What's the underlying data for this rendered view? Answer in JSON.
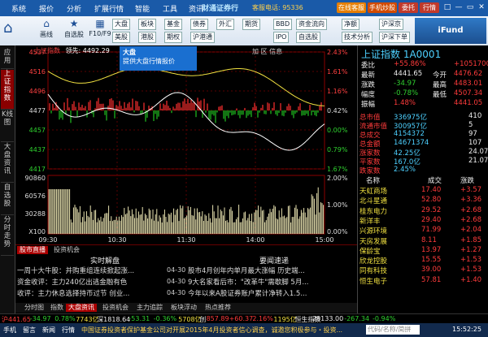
{
  "titlebar": {
    "menu": [
      "系统",
      "报价",
      "分析",
      "扩展行情",
      "智能",
      "工具",
      "资讯"
    ],
    "brand": "财通证券行",
    "hotline": "客服电话: 95336",
    "buttons": [
      "在线客服",
      "手机炒股",
      "委托",
      "行情"
    ],
    "win_controls": [
      "□",
      "—",
      "▭",
      "✕"
    ]
  },
  "toolbar": {
    "tools": [
      {
        "icon": "⌂",
        "label": "画线",
        "name": "draw-line-icon"
      },
      {
        "icon": "★",
        "label": "自选股",
        "name": "watchlist-icon"
      },
      {
        "icon": "▦",
        "label": "F10/F9",
        "name": "f10-icon"
      }
    ],
    "selects": [
      "大盘",
      "板块",
      "基金",
      "债券",
      "外汇",
      "期货",
      "美股",
      "港股",
      "期权",
      "沪港通",
      "BBD",
      "IPO",
      "资金流向",
      "自选股",
      "净额",
      "技术分析",
      "沪深京",
      "沪深下单"
    ],
    "logo": "iFund"
  },
  "left_tabs": [
    "应用",
    "上证指数",
    "K线图",
    "大盘资讯",
    "自选股",
    "分时走势"
  ],
  "chart": {
    "header_name": "上证指数",
    "header_value": "领先: 4492.29",
    "ops": "加 区 信息",
    "tooltip_title": "大盘",
    "tooltip_text": "提供大盘行情报价",
    "y_left": [
      "4537",
      "4516",
      "4496",
      "4477",
      "4457",
      "4437",
      "4417"
    ],
    "y_right": [
      "2.43%",
      "1.61%",
      "1.16%",
      "0.42%",
      "0.00%",
      "0.79%",
      "1.67%"
    ],
    "vol_left": [
      "90860",
      "60576",
      "30288",
      "X100"
    ],
    "vol_right": [
      "2.00%",
      "1.00%",
      "0.00%"
    ],
    "x_labels": [
      "09:30",
      "10:30",
      "11:30",
      "14:00",
      "15:00"
    ]
  },
  "news": {
    "tabs": [
      "股市直播",
      "投资机会"
    ],
    "sub_heads": [
      "实时解盘",
      "要闻速递"
    ],
    "rows": [
      {
        "left": "一周十大牛股：并购重组连续掀起涨...",
        "time": "04-30",
        "right": "股市4月创年内单月最大涨幅 历史端..."
      },
      {
        "left": "资金收评：主力240亿出逃金融有色",
        "time": "04-30",
        "right": "9大名家看后市：\"改革牛\"需歇脚 5月..."
      },
      {
        "left": "收评：主力休息选择持币过节 创业...",
        "time": "04-30",
        "right": "今年以来A股证券账户累计净转入1.5..."
      }
    ],
    "ticker_tabs": [
      "分时图",
      "指数",
      "大盘资讯",
      "投资机会",
      "主力追踪",
      "板块浮动",
      "热点推荐"
    ]
  },
  "right_panel": {
    "title": "上证指数 1A0001",
    "quote": [
      {
        "l": "委比",
        "v": "+55.86%",
        "r": "+10517003"
      },
      {
        "l": "最新",
        "v": "4441.65",
        "r": "4476.62"
      },
      {
        "l": "涨跌",
        "v": "-34.97",
        "r": "4483.01"
      },
      {
        "l": "幅度",
        "v": "-0.78%",
        "r": "4507.34"
      },
      {
        "l": "振幅",
        "v": "1.48%",
        "r": "4441.05"
      }
    ],
    "quote_labels": [
      "今开",
      "最高",
      "最低"
    ],
    "stats": [
      {
        "l": "总市值",
        "v": "336975亿"
      },
      {
        "l": "流通市值",
        "v": "300957亿"
      },
      {
        "l": "总成交",
        "v": "4154372"
      },
      {
        "l": "总金额",
        "v": "14671374"
      },
      {
        "l": "涨家数",
        "v": "42.25亿"
      },
      {
        "l": "平家数",
        "v": "167.0亿"
      },
      {
        "l": "跌家数",
        "v": "2.45%"
      }
    ],
    "stats_right": [
      "410",
      "5",
      "97",
      "107",
      "24.07",
      "21.07"
    ],
    "list_header": [
      "名称",
      "成交",
      "涨跌"
    ],
    "stocks": [
      {
        "name": "天虹商场",
        "price": "17.40",
        "chg": "+3.57"
      },
      {
        "name": "北斗星通",
        "price": "52.80",
        "chg": "+3.36"
      },
      {
        "name": "桂东电力",
        "price": "29.52",
        "chg": "+2.68"
      },
      {
        "name": "新洋丰",
        "price": "29.40",
        "chg": "+2.68"
      },
      {
        "name": "兴源环境",
        "price": "71.99",
        "chg": "+2.04"
      },
      {
        "name": "天房发展",
        "price": "8.11",
        "chg": "+1.85"
      },
      {
        "name": "保龄宝",
        "price": "13.97",
        "chg": "+1.27"
      },
      {
        "name": "欣龙控股",
        "price": "15.55",
        "chg": "+1.53"
      },
      {
        "name": "同有科技",
        "price": "39.00",
        "chg": "+1.53"
      },
      {
        "name": "恒生电子",
        "price": "57.81",
        "chg": "+1.40"
      }
    ]
  },
  "ticker": [
    {
      "t": "沪441.65",
      "c": "red"
    },
    {
      "t": "-34.97",
      "c": "green"
    },
    {
      "t": "0.78%",
      "c": "green"
    },
    {
      "t": "7743亿",
      "c": "yel"
    },
    {
      "t": "深1818.64",
      "c": "wht"
    },
    {
      "t": "-53.31",
      "c": "green"
    },
    {
      "t": "-0.36%",
      "c": "green"
    },
    {
      "t": "5708亿",
      "c": "yel"
    },
    {
      "t": "创",
      "c": "wht"
    },
    {
      "t": "857.89+60.37",
      "c": "red"
    },
    {
      "t": "2.16%",
      "c": "red"
    },
    {
      "t": "1195亿",
      "c": "yel"
    },
    {
      "t": "恒生指数",
      "c": "wht"
    },
    {
      "t": "28133.00",
      "c": "wht"
    },
    {
      "t": "-267.34",
      "c": "green"
    },
    {
      "t": "-0.94%",
      "c": "green"
    }
  ],
  "status": {
    "items": [
      "手机",
      "留言",
      "新闻",
      "行情"
    ],
    "scroll": "中国证券投资者保护基金公司对开展2015年4月投资者信心调查，诚邀您积极参与・投资...",
    "search": "代码/名称/简拼",
    "time": "15:52:25"
  }
}
